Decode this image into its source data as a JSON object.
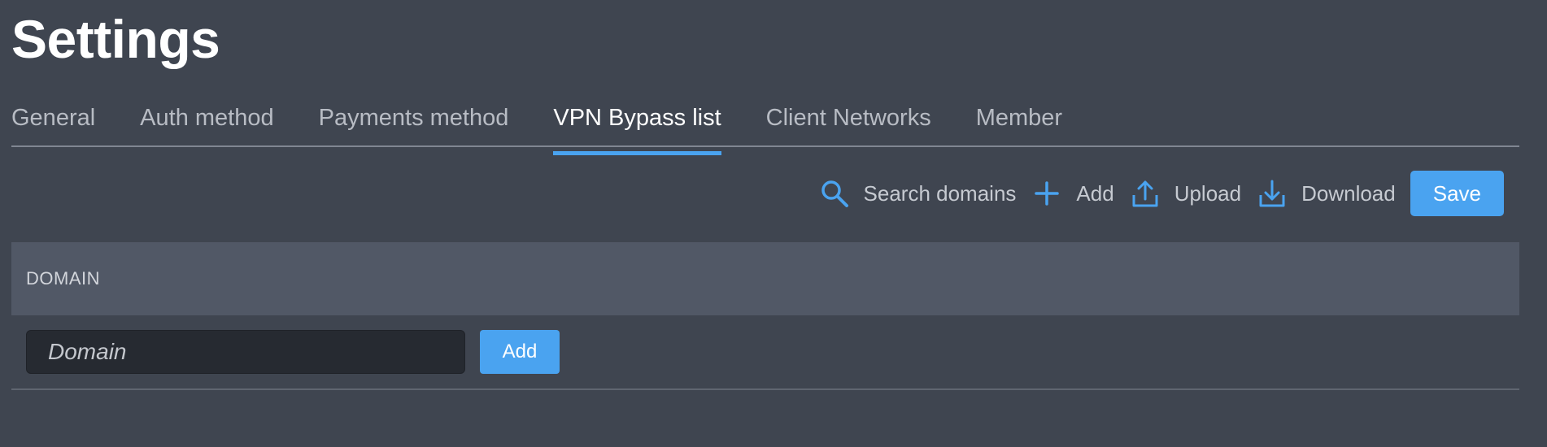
{
  "page": {
    "title": "Settings"
  },
  "tabs": [
    {
      "label": "General",
      "active": false
    },
    {
      "label": "Auth method",
      "active": false
    },
    {
      "label": "Payments method",
      "active": false
    },
    {
      "label": "VPN Bypass list",
      "active": true
    },
    {
      "label": "Client Networks",
      "active": false
    },
    {
      "label": "Member",
      "active": false
    }
  ],
  "toolbar": {
    "search_label": "Search domains",
    "search_icon": "search-icon",
    "add_label": "Add",
    "add_icon": "plus-icon",
    "upload_label": "Upload",
    "upload_icon": "upload-icon",
    "download_label": "Download",
    "download_icon": "download-icon",
    "save_label": "Save"
  },
  "table": {
    "column_domain": "DOMAIN"
  },
  "add_row": {
    "domain_placeholder": "Domain",
    "domain_value": "",
    "add_label": "Add"
  },
  "colors": {
    "background": "#3f4550",
    "accent": "#4aa3f0",
    "header_row": "#515866",
    "input_bg": "#262a31"
  }
}
